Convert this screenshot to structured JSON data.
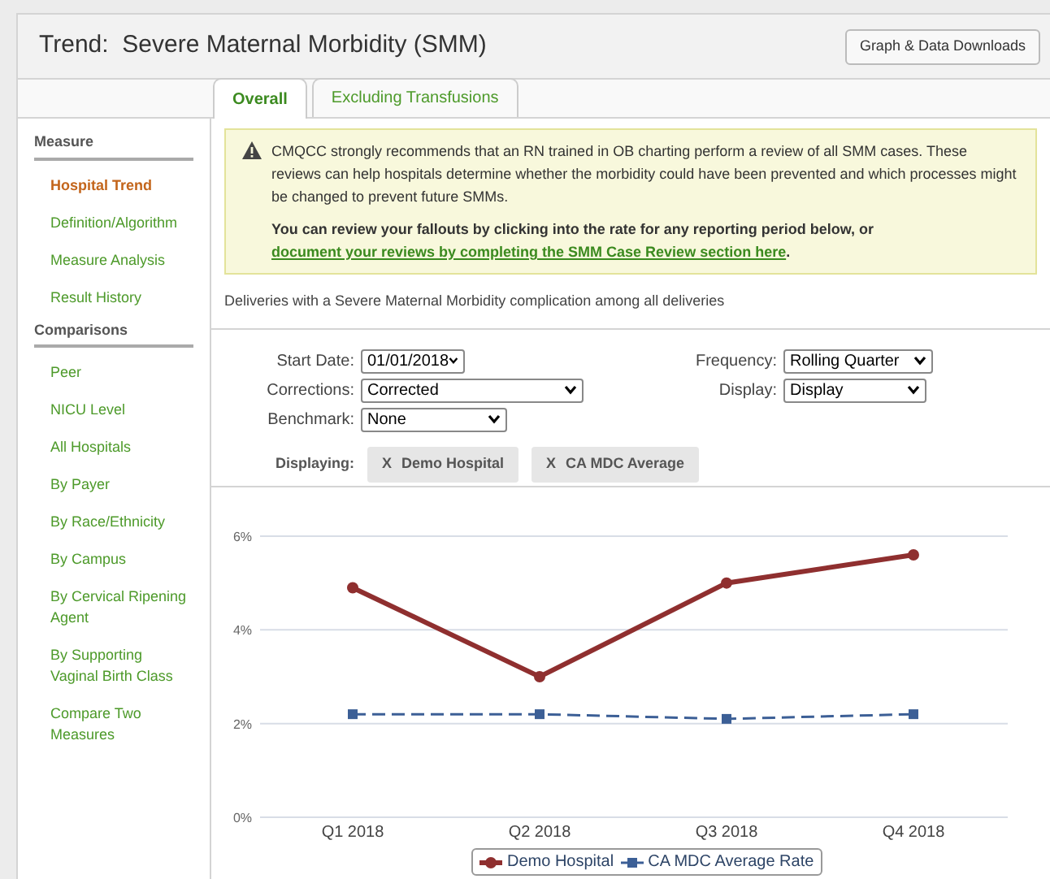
{
  "header": {
    "title": "Trend:  Severe Maternal Morbidity (SMM)",
    "download_button": "Graph & Data Downloads"
  },
  "tabs": [
    {
      "label": "Overall",
      "selected": true
    },
    {
      "label": "Excluding Transfusions",
      "selected": false
    }
  ],
  "sidebar": [
    {
      "heading": "Measure",
      "items": [
        {
          "label": "Hospital Trend",
          "selected": true
        },
        {
          "label": "Definition/Algorithm",
          "selected": false
        },
        {
          "label": "Measure Analysis",
          "selected": false
        },
        {
          "label": "Result History",
          "selected": false
        }
      ]
    },
    {
      "heading": "Comparisons",
      "items": [
        {
          "label": "Peer",
          "selected": false
        },
        {
          "label": "NICU Level",
          "selected": false
        },
        {
          "label": "All Hospitals",
          "selected": false
        },
        {
          "label": "By Payer",
          "selected": false
        },
        {
          "label": "By Race/Ethnicity",
          "selected": false
        },
        {
          "label": "By Campus",
          "selected": false
        },
        {
          "label": "By Cervical Ripening Agent",
          "selected": false
        },
        {
          "label": "By Supporting Vaginal Birth Class",
          "selected": false
        },
        {
          "label": "Compare Two Measures",
          "selected": false
        }
      ]
    }
  ],
  "alert": {
    "message": "CMQCC strongly recommends that an RN trained in OB charting perform a review of all SMM cases. These reviews can help hospitals determine whether the morbidity could have been prevented and which processes might be changed to prevent future SMMs.",
    "action_text": "You can review your fallouts by clicking into the rate for any reporting period below, or",
    "action_link": "document your reviews by completing the SMM Case Review section here",
    "action_end": "."
  },
  "description": "Deliveries with a Severe Maternal Morbidity complication among all deliveries",
  "filters": [
    {
      "label": "Start Date:",
      "value": "01/01/2018"
    },
    {
      "label": "Frequency:",
      "value": "Rolling Quarter"
    },
    {
      "label": "Corrections:",
      "value": "Corrected"
    },
    {
      "label": "Display:",
      "value": "Display"
    },
    {
      "label": "Benchmark:",
      "value": "None"
    }
  ],
  "displaying": {
    "label": "Displaying:",
    "chips": [
      {
        "remove": "X",
        "label": "Demo Hospital"
      },
      {
        "remove": "X",
        "label": "CA MDC Average"
      }
    ]
  },
  "chart": {
    "chart_data": {
      "type": "line",
      "categories": [
        "Q1 2018",
        "Q2 2018",
        "Q3 2018",
        "Q4 2018"
      ],
      "ylim": [
        0,
        6
      ],
      "yticks": [
        {
          "value": 0,
          "label": "0%"
        },
        {
          "value": 2,
          "label": "2%"
        },
        {
          "value": 4,
          "label": "4%"
        },
        {
          "value": 6,
          "label": "6%"
        }
      ],
      "legend": true,
      "series": [
        {
          "name": "Demo Hospital",
          "color": "#8f2f2f",
          "marker": "circle",
          "line_style": "solid",
          "values": [
            4.9,
            3.0,
            5.0,
            5.6
          ]
        },
        {
          "name": "CA MDC Average Rate",
          "color": "#3c5f96",
          "marker": "square",
          "line_style": "dashed",
          "values": [
            2.2,
            2.2,
            2.1,
            2.2
          ]
        }
      ]
    }
  }
}
